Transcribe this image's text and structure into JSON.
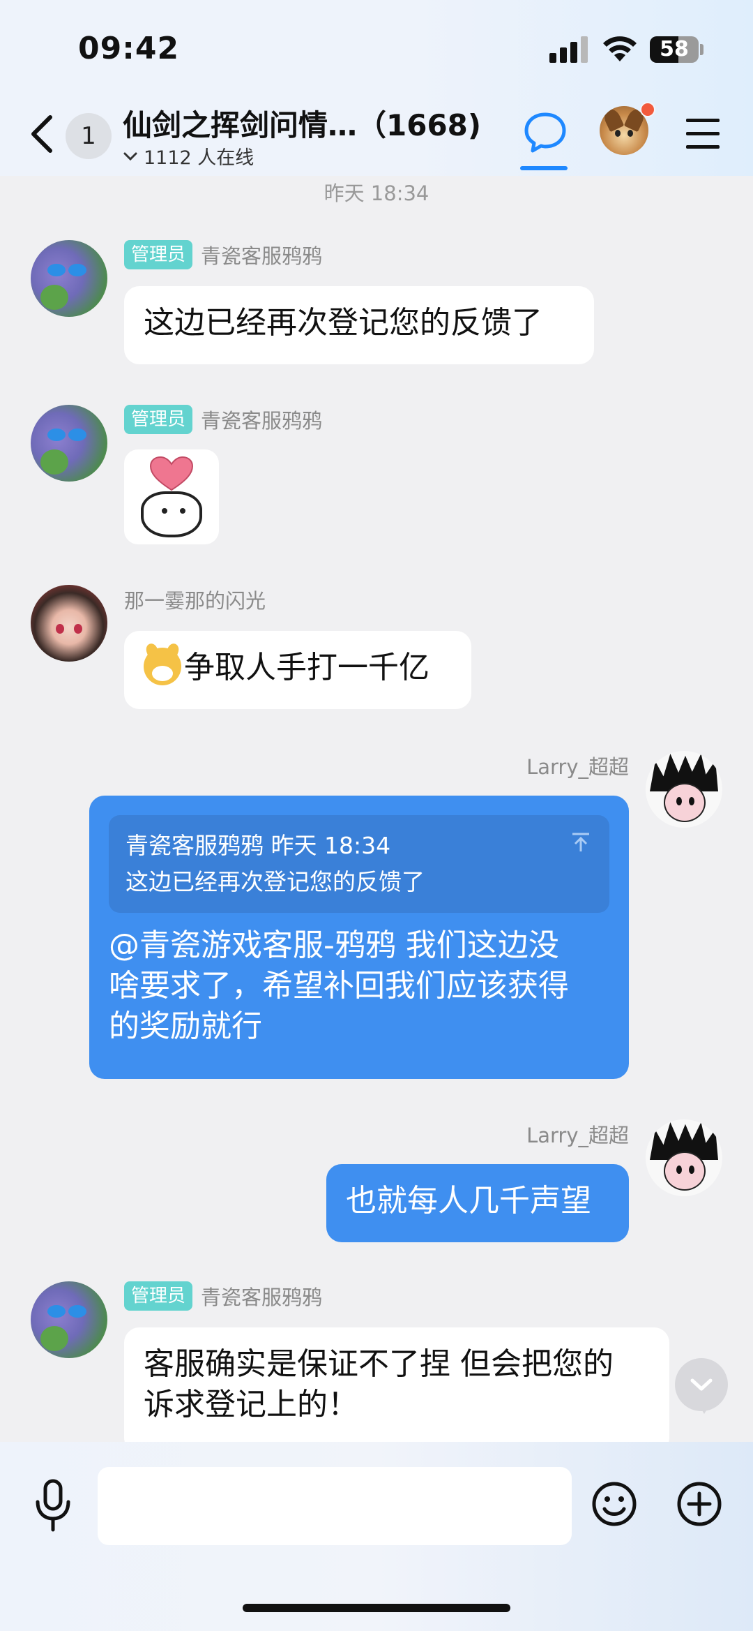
{
  "status_bar": {
    "time": "09:42",
    "battery": "58",
    "battery_level": 0.58
  },
  "header": {
    "unread_count": "1",
    "group_title": "仙剑之挥剑问情…（1668)",
    "online_text": "1112 人在线",
    "icons": {
      "back": "back-arrow-icon",
      "chat": "chat-bubble-icon",
      "menu": "menu-icon",
      "avatar": "eevee-avatar"
    }
  },
  "chat": {
    "timestamp": "昨天 18:34",
    "messages": [
      {
        "type": "text",
        "side": "left",
        "badge": "管理员",
        "sender": "青瓷客服鸦鸦",
        "text": "这边已经再次登记您的反馈了"
      },
      {
        "type": "sticker",
        "side": "left",
        "badge": "管理员",
        "sender": "青瓷客服鸦鸦",
        "sticker": "heart-bear-sticker"
      },
      {
        "type": "text",
        "side": "left",
        "sender": "那一霎那的闪光",
        "emoji": "dog-face-emoji",
        "text": "争取人手打一千亿"
      },
      {
        "type": "reply",
        "side": "right",
        "sender": "Larry_超超",
        "quote": {
          "sender": "青瓷客服鸦鸦",
          "time": "昨天 18:34",
          "text": "这边已经再次登记您的反馈了"
        },
        "text_lines": [
          "@青瓷游戏客服-鸦鸦 我们这边没",
          "啥要求了，希望补回我们应该获得",
          "的奖励就行"
        ]
      },
      {
        "type": "text",
        "side": "right",
        "sender": "Larry_超超",
        "text": "也就每人几千声望"
      },
      {
        "type": "text",
        "side": "left",
        "badge": "管理员",
        "sender": "青瓷客服鸦鸦",
        "text_lines": [
          "客服确实是保证不了捏 但会把您的",
          "诉求登记上的！"
        ]
      }
    ]
  },
  "input_bar": {
    "placeholder": "",
    "icons": {
      "mic": "microphone-icon",
      "emoji": "smiley-icon",
      "plus": "plus-icon"
    }
  },
  "colors": {
    "accent": "#1e88ff",
    "bubble_blue": "#3f8ff0",
    "admin_badge": "#63d3cf",
    "notification": "#f25a3c"
  }
}
